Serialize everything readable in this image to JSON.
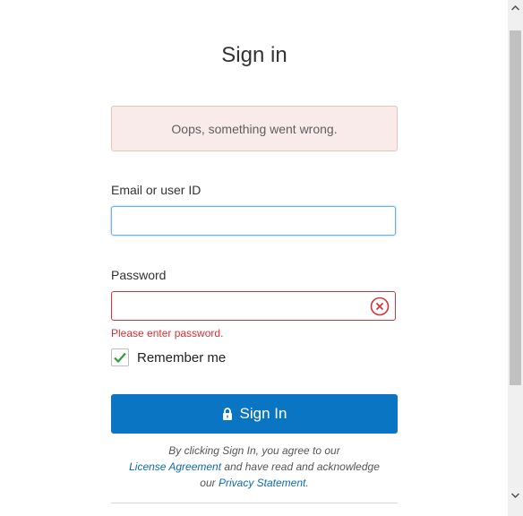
{
  "page": {
    "title": "Sign in"
  },
  "alert": {
    "message": "Oops, something went wrong."
  },
  "email": {
    "label": "Email or user ID",
    "value": ""
  },
  "password": {
    "label": "Password",
    "value": "",
    "error": "Please enter password."
  },
  "remember": {
    "label": "Remember me",
    "checked": true
  },
  "signin": {
    "label": "Sign In"
  },
  "terms": {
    "part1": "By clicking Sign In, you agree to our",
    "license_link": "License Agreement",
    "part2": " and have read and acknowledge",
    "part3": "our ",
    "privacy_link": "Privacy Statement",
    "part4": "."
  },
  "colors": {
    "primary": "#0a75c2",
    "error": "#d0333a",
    "alert_bg": "#f9ebea",
    "check": "#2e9e3e"
  },
  "icons": {
    "error": "circle-x-icon",
    "lock": "lock-icon",
    "check": "checkmark-icon"
  }
}
